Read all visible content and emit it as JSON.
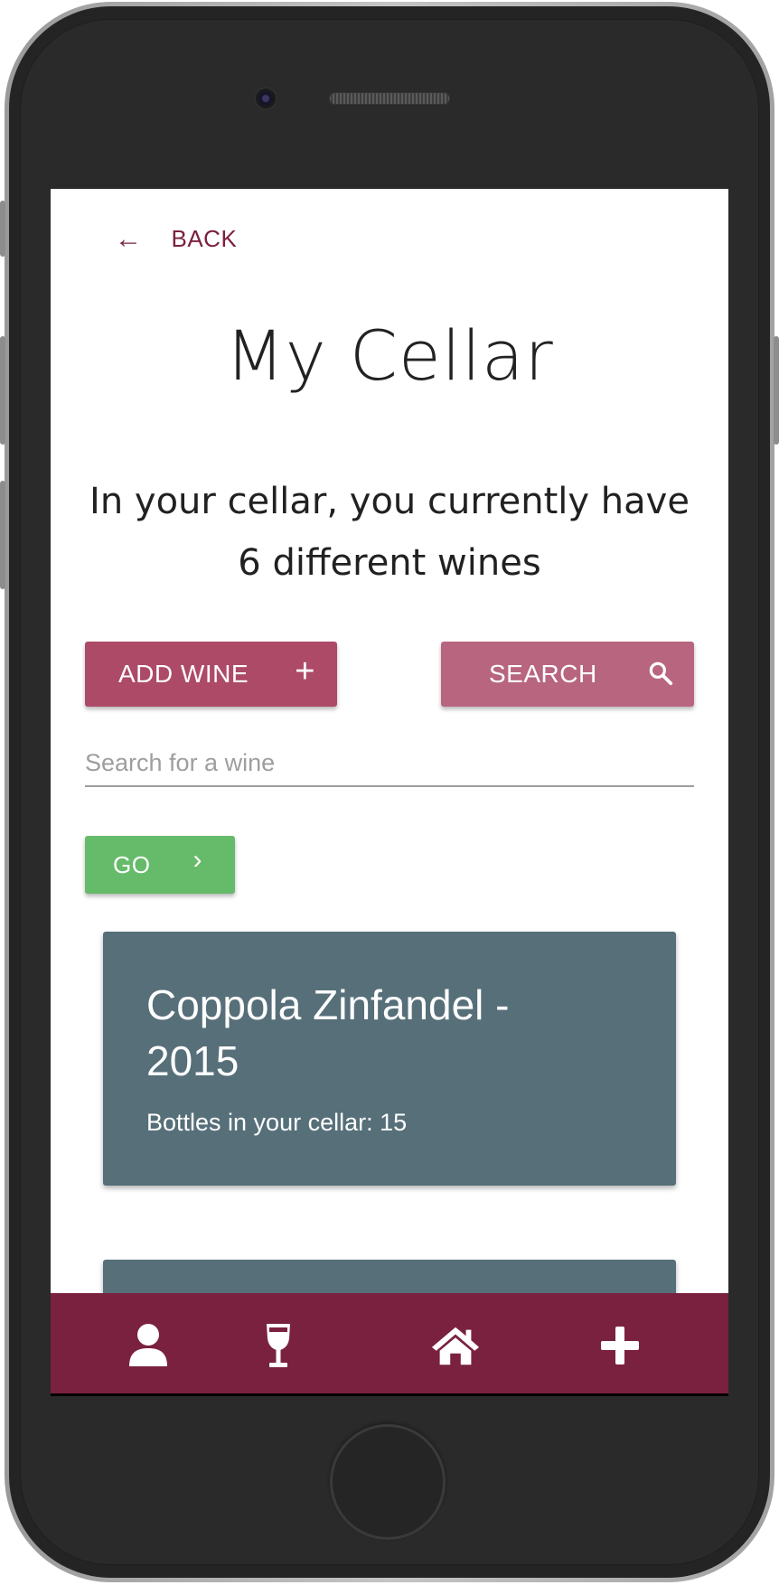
{
  "header": {
    "back_label": "BACK",
    "back_arrow": "←"
  },
  "page": {
    "title": "My Cellar",
    "subtitle": "In your cellar, you currently have 6 different wines"
  },
  "actions": {
    "add_wine_label": "ADD WINE",
    "add_icon": "+",
    "search_label": "SEARCH",
    "search_icon": "search-icon"
  },
  "search": {
    "placeholder": "Search for a wine",
    "value": "",
    "go_label": "GO",
    "go_icon": "›"
  },
  "wines": [
    {
      "name": "Coppola Zinfandel - 2015",
      "bottles_text": "Bottles in your cellar: 15"
    }
  ],
  "bottom_nav": {
    "items": [
      "profile-icon",
      "wine-glass-icon",
      "home-icon",
      "plus-icon"
    ]
  },
  "colors": {
    "brand": "#7a2140",
    "add_button": "#ad4a68",
    "search_button": "#b86580",
    "go_button": "#66bb6a",
    "card": "#566f79"
  }
}
